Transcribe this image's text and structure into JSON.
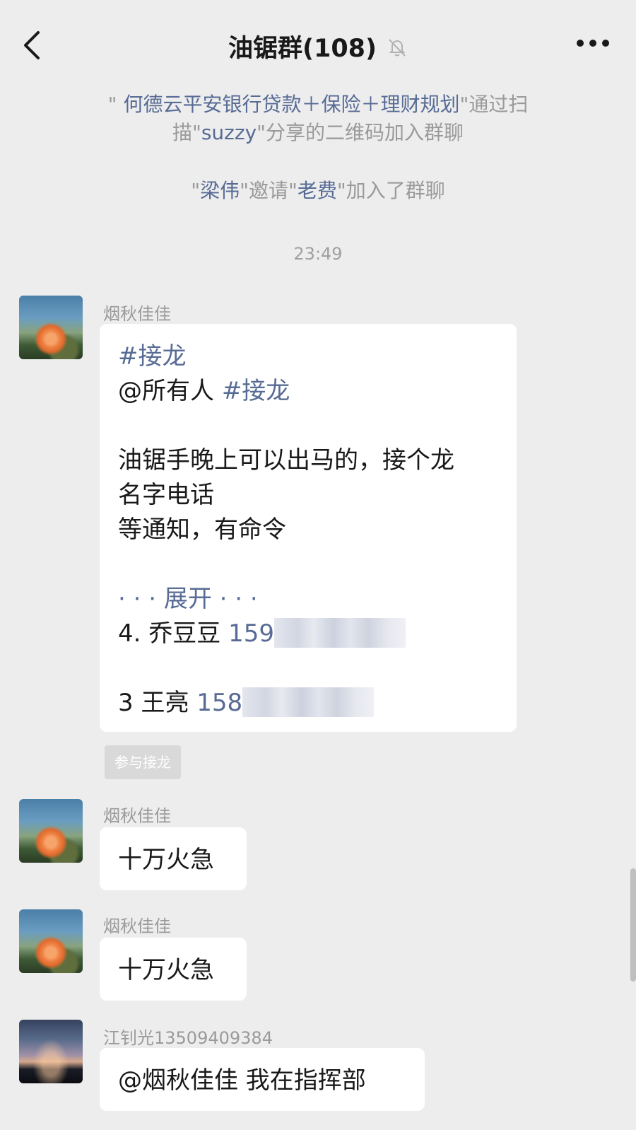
{
  "header": {
    "title": "油锯群(108)",
    "back_icon": "chevron-left-icon",
    "mute_icon": "bell-off-icon",
    "more_icon": "more-dots-icon"
  },
  "system_messages": [
    {
      "open": "\" ",
      "name": "何德云平安银行贷款＋保险＋理财规划",
      "mid": "\"通过扫描\"",
      "name2": "suzzy",
      "tail": "\"分享的二维码加入群聊"
    },
    {
      "open": "\"",
      "name": "梁伟",
      "mid": "\"邀请\"",
      "name2": "老费",
      "tail": "\"加入了群聊"
    }
  ],
  "timestamp": "23:49",
  "messages": [
    {
      "sender": "烟秋佳佳",
      "avatar": "flower-avatar",
      "lines": [
        {
          "tag": "#接龙"
        },
        {
          "text": "@所有人 ",
          "tag": "#接龙"
        },
        {
          "text": ""
        },
        {
          "text": "油锯手晚上可以出马的，接个龙"
        },
        {
          "text": "名字电话"
        },
        {
          "text": "等通知，有命令"
        },
        {
          "text": ""
        },
        {
          "tag": "· · · 展开 · · ·"
        },
        {
          "text": "4. 乔豆豆  ",
          "phone": "159"
        },
        {
          "text": ""
        },
        {
          "text": "3 王亮 ",
          "phone": "158"
        }
      ],
      "action_button": "参与接龙"
    },
    {
      "sender": "烟秋佳佳",
      "avatar": "flower-avatar",
      "text": "十万火急"
    },
    {
      "sender": "烟秋佳佳",
      "avatar": "flower-avatar",
      "text": "十万火急"
    },
    {
      "sender": "江钊光13509409384",
      "avatar": "dusk-avatar",
      "text": "@烟秋佳佳  我在指挥部"
    }
  ],
  "colors": {
    "background": "#ededed",
    "link": "#576b95",
    "bubble": "#ffffff",
    "system_text": "#9a9a9a"
  }
}
